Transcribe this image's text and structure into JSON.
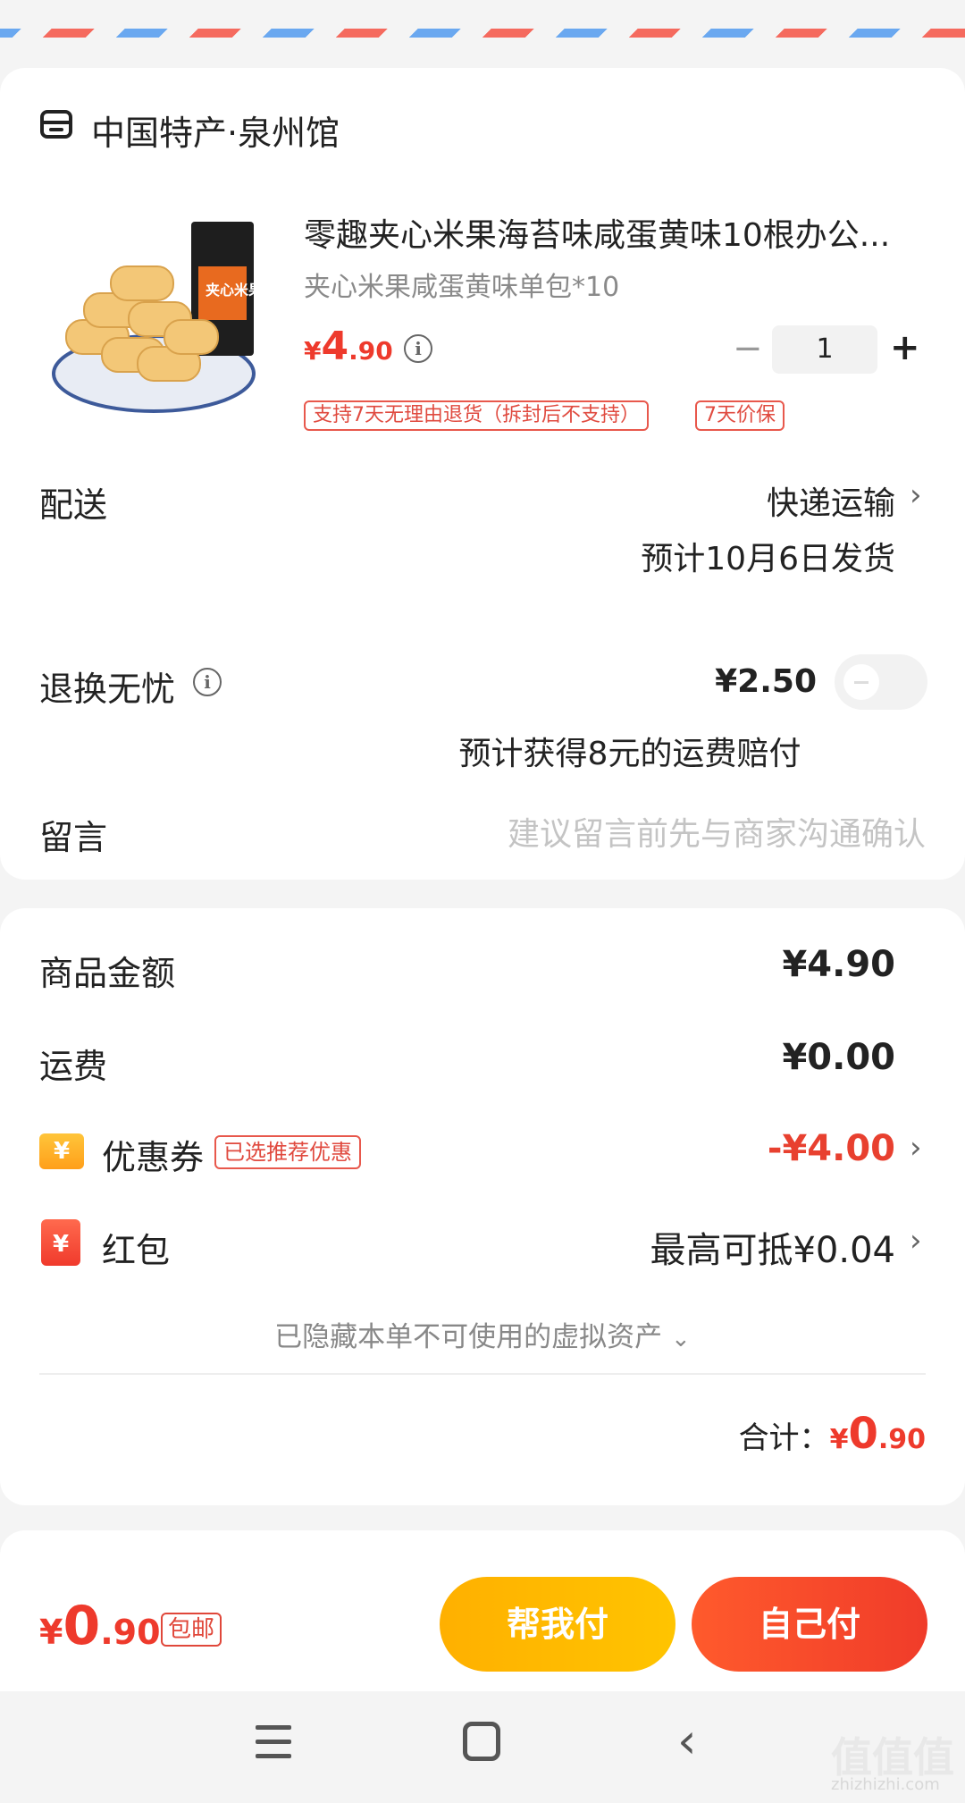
{
  "shop": {
    "name": "中国特产·泉州馆"
  },
  "product": {
    "title": "零趣夹心米果海苔味咸蛋黄味10根办公...",
    "sku": "夹心米果咸蛋黄味单包*10",
    "price_symbol": "¥",
    "price_int": "4",
    "price_dec": ".90",
    "quantity": "1",
    "image_label": "夹心米果",
    "tags": [
      "支持7天无理由退货（拆封后不支持）",
      "7天价保"
    ]
  },
  "delivery": {
    "label": "配送",
    "method": "快递运输",
    "estimate": "预计10月6日发货"
  },
  "returns": {
    "label": "退换无忧",
    "price": "¥2.50",
    "note": "预计获得8元的运费赔付",
    "enabled": false
  },
  "message": {
    "label": "留言",
    "placeholder": "建议留言前先与商家沟通确认"
  },
  "summary": {
    "goods_label": "商品金额",
    "goods_value": "¥4.90",
    "shipping_label": "运费",
    "shipping_value": "¥0.00",
    "coupon_label": "优惠券",
    "coupon_tag": "已选推荐优惠",
    "coupon_value": "-¥4.00",
    "hongbao_label": "红包",
    "hongbao_value": "最高可抵¥0.04",
    "hidden_assets": "已隐藏本单不可使用的虚拟资产",
    "total_label": "合计：",
    "total_symbol": "¥",
    "total_int": "0",
    "total_dec": ".90",
    "icon_symbol": "¥"
  },
  "bottom": {
    "price_symbol": "¥",
    "price_int": "0",
    "price_dec": ".90",
    "baoyou": "包邮",
    "help_pay": "帮我付",
    "self_pay": "自己付"
  },
  "watermark": {
    "main": "值值值",
    "sub": "zhizhizhi.com"
  },
  "colors": {
    "accent_red": "#ee3a2c",
    "help_btn": "#ffb800",
    "self_btn": "#f5462c"
  }
}
